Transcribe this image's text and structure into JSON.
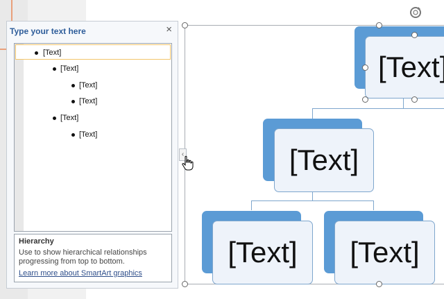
{
  "text_pane": {
    "title": "Type your text here",
    "close_glyph": "×",
    "outline": [
      {
        "level": 1,
        "text": "[Text]",
        "selected": true
      },
      {
        "level": 2,
        "text": "[Text]"
      },
      {
        "level": 3,
        "text": "[Text]"
      },
      {
        "level": 3,
        "text": "[Text]"
      },
      {
        "level": 2,
        "text": "[Text]"
      },
      {
        "level": 3,
        "text": "[Text]"
      }
    ],
    "info": {
      "title": "Hierarchy",
      "description": "Use to show hierarchical relationships progressing from top to bottom.",
      "link": "Learn more about SmartArt graphics"
    }
  },
  "collapse_glyph": "‹",
  "shapes": {
    "top": "[Text]",
    "mid": "[Text]",
    "bottom_left": "[Text]",
    "bottom_right": "[Text]"
  },
  "colors": {
    "accent": "#5b9bd5",
    "shape_fill": "#eef3fa",
    "title_blue": "#2e5d9a"
  }
}
